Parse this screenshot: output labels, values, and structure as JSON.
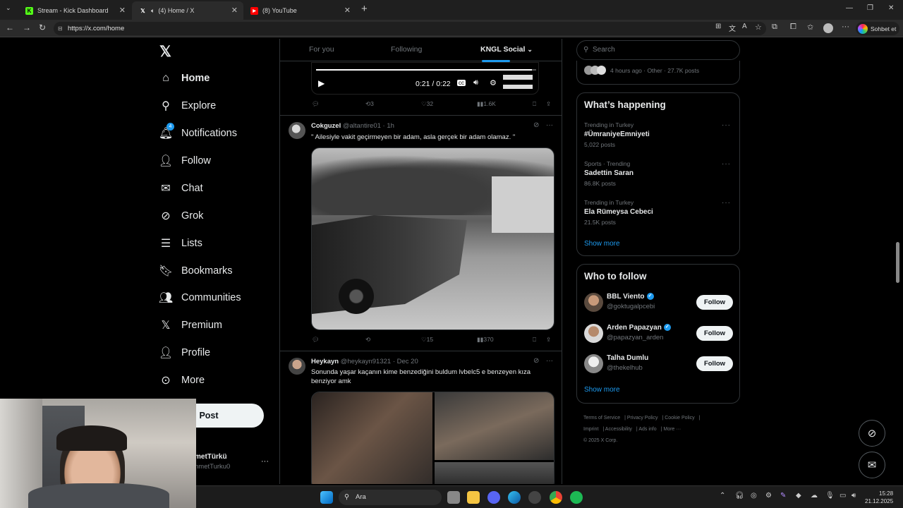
{
  "browser": {
    "tabs": [
      {
        "title": "Stream - Kick Dashboard",
        "icon": "kick-icon",
        "color": "#53fc18"
      },
      {
        "title": "(4) Home / X",
        "icon": "x-logo-icon",
        "color": "#ffffff"
      },
      {
        "title": "(8) YouTube",
        "icon": "youtube-icon",
        "color": "#ff0000"
      }
    ],
    "url": "https://x.com/home",
    "copilot_label": "Sohbet et"
  },
  "nav": {
    "items": [
      {
        "label": "Home",
        "icon": "home-icon"
      },
      {
        "label": "Explore",
        "icon": "search-icon"
      },
      {
        "label": "Notifications",
        "icon": "bell-icon",
        "badge": "4"
      },
      {
        "label": "Follow",
        "icon": "follow-icon"
      },
      {
        "label": "Chat",
        "icon": "mail-icon"
      },
      {
        "label": "Grok",
        "icon": "grok-icon"
      },
      {
        "label": "Lists",
        "icon": "list-icon"
      },
      {
        "label": "Bookmarks",
        "icon": "bookmark-icon"
      },
      {
        "label": "Communities",
        "icon": "communities-icon"
      },
      {
        "label": "Premium",
        "icon": "x-icon"
      },
      {
        "label": "Profile",
        "icon": "profile-icon"
      },
      {
        "label": "More",
        "icon": "more-circle-icon"
      }
    ],
    "post_label": "Post",
    "account_name": "metTürkü",
    "account_handle": "nmetTurku0"
  },
  "feed": {
    "tabs": [
      "For you",
      "Following",
      "KNGL Social"
    ],
    "active_tab": "KNGL Social",
    "video": {
      "time": "0:21 / 0:22",
      "actions": {
        "replies": "",
        "reposts": "3",
        "likes": "32",
        "views": "1.6K"
      }
    },
    "posts": [
      {
        "name": "Cokguzel",
        "handle": "@altantire01",
        "time": "1h",
        "text": "\" Ailesiyle vakit geçirmeyen bir adam, asla gerçek bir adam olamaz. \"",
        "actions": {
          "replies": "",
          "reposts": "",
          "likes": "15",
          "views": "370"
        }
      },
      {
        "name": "Heykayn",
        "handle": "@heykayn91321",
        "time": "Dec 20",
        "text": "Sonunda yaşar kaçanın kime benzediğini buldum lvbelc5 e benzeyen kıza benziyor amk"
      }
    ]
  },
  "sidebar": {
    "search_placeholder": "Search",
    "top_meta": "4 hours ago · Other · 27.7K posts",
    "whats_happening": {
      "title": "What’s happening",
      "trends": [
        {
          "meta": "Trending in Turkey",
          "name": "#ÜmraniyeEmniyeti",
          "count": "5,022 posts"
        },
        {
          "meta": "Sports · Trending",
          "name": "Sadettin Saran",
          "count": "86.8K posts"
        },
        {
          "meta": "Trending in Turkey",
          "name": "Ela Rümeysa Cebeci",
          "count": "21.5K posts"
        }
      ],
      "show_more": "Show more"
    },
    "who_to_follow": {
      "title": "Who to follow",
      "users": [
        {
          "name": "BBL Viento",
          "handle": "@goktugalpcebi",
          "verified": true,
          "button": "Follow"
        },
        {
          "name": "Arden Papazyan",
          "handle": "@papazyan_arden",
          "verified": true,
          "button": "Follow"
        },
        {
          "name": "Talha Dumlu",
          "handle": "@thekelhub",
          "verified": false,
          "button": "Follow"
        }
      ],
      "show_more": "Show more"
    },
    "footer": {
      "links": [
        "Terms of Service",
        "Privacy Policy",
        "Cookie Policy",
        "Imprint",
        "Accessibility",
        "Ads info",
        "More ···"
      ],
      "copyright": "© 2025 X Corp."
    }
  },
  "taskbar": {
    "search_label": "Ara",
    "time": "15:28",
    "date": "21.12.2025"
  }
}
